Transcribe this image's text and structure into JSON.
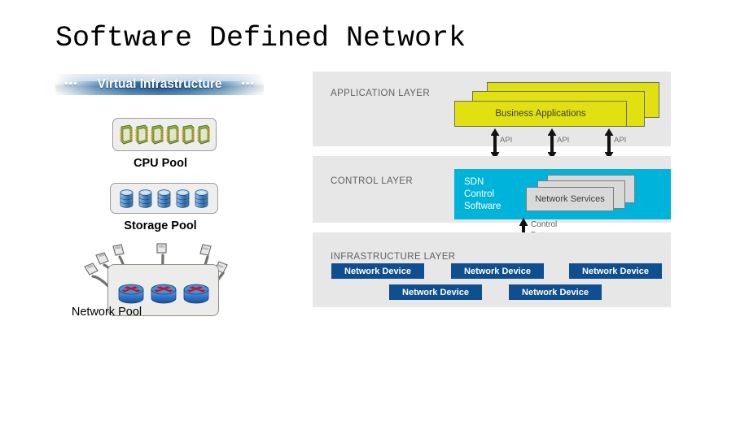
{
  "slide": {
    "title": "Software Defined Network"
  },
  "left_panel": {
    "banner": {
      "label": "Virtual Infrastructure",
      "dots_left": "•••",
      "dots_right": "•••",
      "color_start": "#ffffff",
      "color_mid": "#215d95"
    },
    "pools": [
      {
        "id": "cpu",
        "label": "CPU Pool",
        "icon": "cpu-chip-icon",
        "icon_count": 6,
        "icon_color": "#8fae3a"
      },
      {
        "id": "storage",
        "label": "Storage Pool",
        "icon": "database-cylinder-icon",
        "icon_count": 5,
        "icon_color": "#2f6fb5"
      },
      {
        "id": "network",
        "label": "Network Pool",
        "icon": "router-icon",
        "icon_count": 3,
        "icon_color": "#2f76c8",
        "cable_count": 6,
        "cable_connector": "rj45-connector-icon"
      }
    ]
  },
  "sdn": {
    "layers": [
      {
        "id": "application",
        "title": "APPLICATION LAYER"
      },
      {
        "id": "control",
        "title": "CONTROL LAYER"
      },
      {
        "id": "infrastructure",
        "title": "INFRASTRUCTURE LAYER"
      }
    ],
    "application": {
      "box_label": "Business Applications",
      "box_count": 3,
      "box_color": "#e1e112"
    },
    "api_arrows": [
      {
        "label": "API"
      },
      {
        "label": "API"
      },
      {
        "label": "API"
      }
    ],
    "control": {
      "controller_label": "SDN\nControl\nSoftware",
      "controller_color": "#00b3db",
      "services_label": "Network Services",
      "services_count": 3,
      "services_color": "#d9d9d9"
    },
    "cdpi": {
      "label": "Control Data Plane interface\n(e.g., OpenFlow)"
    },
    "infrastructure": {
      "device_color": "#104f8f",
      "devices": [
        {
          "label": "Network Device"
        },
        {
          "label": "Network Device"
        },
        {
          "label": "Network Device"
        },
        {
          "label": "Network Device"
        },
        {
          "label": "Network Device"
        }
      ]
    }
  }
}
